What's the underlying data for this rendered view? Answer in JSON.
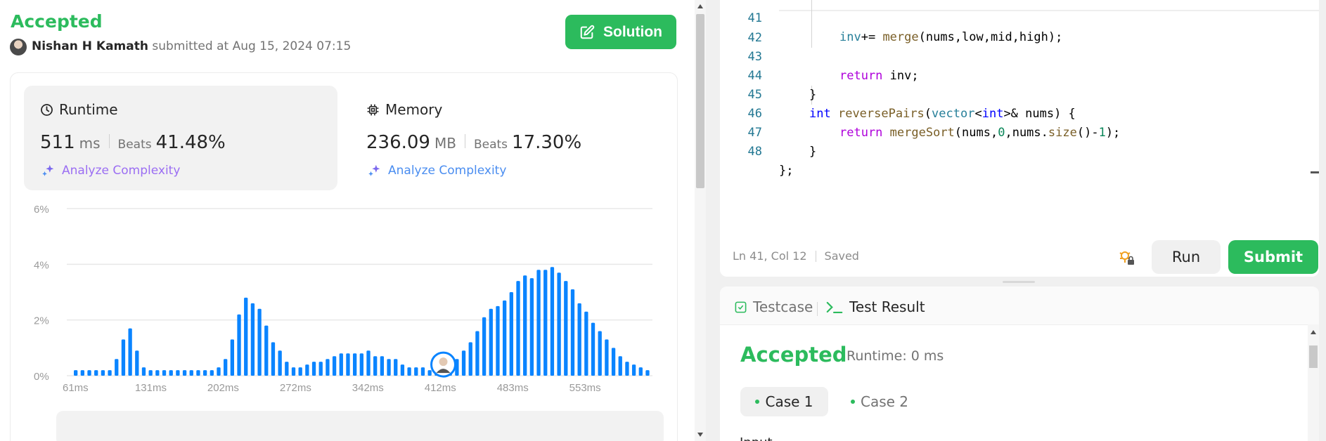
{
  "submission": {
    "status": "Accepted",
    "author": "Nishan H Kamath",
    "submitted_text": "submitted at Aug 15, 2024 07:15",
    "solution_button": "Solution"
  },
  "runtime": {
    "label": "Runtime",
    "value": "511",
    "unit": "ms",
    "beats_label": "Beats",
    "beats_value": "41.48%",
    "analyze": "Analyze Complexity"
  },
  "memory": {
    "label": "Memory",
    "value": "236.09",
    "unit": "MB",
    "beats_label": "Beats",
    "beats_value": "17.30%",
    "analyze": "Analyze Complexity"
  },
  "chart_data": {
    "type": "bar",
    "title": "",
    "xlabel": "",
    "ylabel": "",
    "y_ticks": [
      "0%",
      "2%",
      "4%",
      "6%"
    ],
    "x_ticks": [
      "61ms",
      "131ms",
      "202ms",
      "272ms",
      "342ms",
      "412ms",
      "483ms",
      "553ms"
    ],
    "ylim": [
      0,
      6
    ],
    "grid": true,
    "highlight_index": 54,
    "values": [
      0.2,
      0.2,
      0.2,
      0.2,
      0.2,
      0.2,
      0.6,
      1.3,
      1.7,
      0.9,
      0.3,
      0.2,
      0.2,
      0.2,
      0.2,
      0.2,
      0.2,
      0.2,
      0.2,
      0.2,
      0.2,
      0.3,
      0.6,
      1.3,
      2.2,
      2.8,
      2.6,
      2.4,
      1.8,
      1.2,
      0.9,
      0.5,
      0.3,
      0.3,
      0.4,
      0.5,
      0.5,
      0.6,
      0.7,
      0.8,
      0.8,
      0.8,
      0.8,
      0.9,
      0.7,
      0.7,
      0.6,
      0.6,
      0.4,
      0.3,
      0.3,
      0.3,
      0.2,
      0.2,
      0.3,
      0.4,
      0.6,
      0.9,
      1.2,
      1.6,
      2.1,
      2.4,
      2.5,
      2.7,
      3.0,
      3.4,
      3.6,
      3.5,
      3.8,
      3.8,
      3.9,
      3.7,
      3.4,
      3.1,
      2.6,
      2.3,
      1.9,
      1.6,
      1.3,
      1.0,
      0.7,
      0.5,
      0.4,
      0.3,
      0.2
    ]
  },
  "editor": {
    "lines": [
      {
        "n": "41",
        "code": "inv+= merge(nums,low,mid,high);"
      },
      {
        "n": "42",
        "code": ""
      },
      {
        "n": "43",
        "code": "return inv;"
      },
      {
        "n": "44",
        "code": "}"
      },
      {
        "n": "45",
        "code": "int reversePairs(vector<int>& nums) {"
      },
      {
        "n": "46",
        "code": "return mergeSort(nums,0,nums.size()-1);"
      },
      {
        "n": "47",
        "code": "}"
      },
      {
        "n": "48",
        "code": "};"
      }
    ],
    "cursor": "Ln 41, Col 12",
    "saved": "Saved",
    "run": "Run",
    "submit": "Submit"
  },
  "results": {
    "tab_testcase": "Testcase",
    "tab_result": "Test Result",
    "status": "Accepted",
    "runtime": "Runtime: 0 ms",
    "case1": "Case 1",
    "case2": "Case 2",
    "peek": "Input"
  },
  "colors": {
    "accent_green": "#2cbb5d",
    "bar_blue": "#0a84ff",
    "analyze_purple": "#9b6ef3"
  }
}
